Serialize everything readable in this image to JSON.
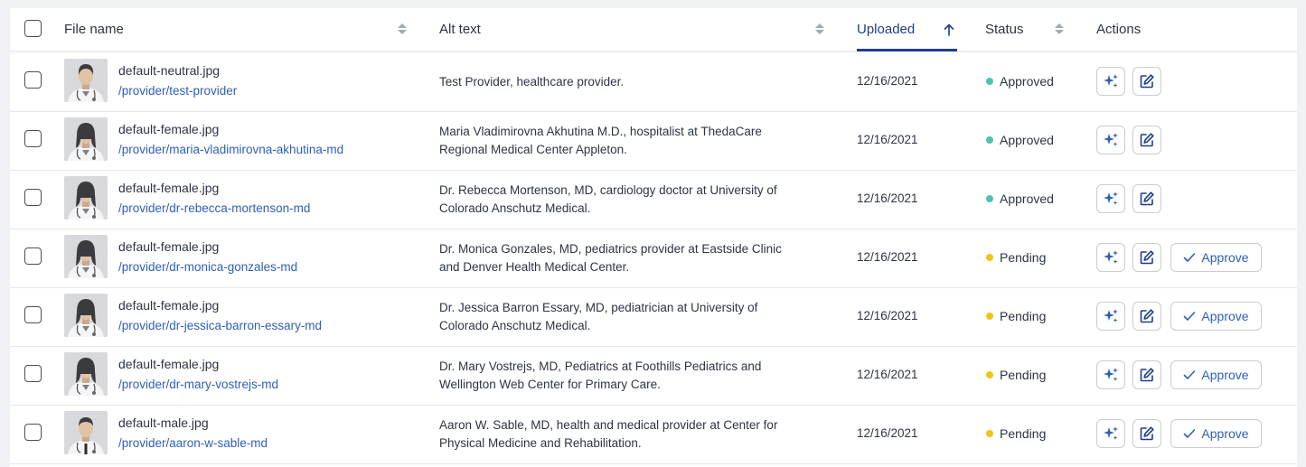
{
  "header": {
    "file_name": "File name",
    "alt_text": "Alt text",
    "uploaded": "Uploaded",
    "status": "Status",
    "actions": "Actions"
  },
  "colors": {
    "approved": "#4fc3b0",
    "pending": "#f0c419",
    "link": "#2e5fb5",
    "active_sort": "#1f3d8a"
  },
  "icons": {
    "ai": "sparkle-icon",
    "edit": "edit-icon",
    "approve": "check-icon"
  },
  "rows": [
    {
      "file": "default-neutral.jpg",
      "path": "/provider/test-provider",
      "alt": "Test Provider, healthcare provider.",
      "date": "12/16/2021",
      "status": "Approved",
      "avatar": "neutral"
    },
    {
      "file": "default-female.jpg",
      "path": "/provider/maria-vladimirovna-akhutina-md",
      "alt": "Maria Vladimirovna Akhutina M.D., hospitalist at ThedaCare Regional Medical Center Appleton.",
      "date": "12/16/2021",
      "status": "Approved",
      "avatar": "female"
    },
    {
      "file": "default-female.jpg",
      "path": "/provider/dr-rebecca-mortenson-md",
      "alt": "Dr. Rebecca Mortenson, MD, cardiology doctor at University of Colorado Anschutz Medical.",
      "date": "12/16/2021",
      "status": "Approved",
      "avatar": "female"
    },
    {
      "file": "default-female.jpg",
      "path": "/provider/dr-monica-gonzales-md",
      "alt": "Dr. Monica Gonzales, MD, pediatrics provider at Eastside Clinic and Denver Health Medical Center.",
      "date": "12/16/2021",
      "status": "Pending",
      "avatar": "female",
      "approve_label": "Approve"
    },
    {
      "file": "default-female.jpg",
      "path": "/provider/dr-jessica-barron-essary-md",
      "alt": "Dr. Jessica Barron Essary, MD, pediatrician at University of Colorado Anschutz Medical.",
      "date": "12/16/2021",
      "status": "Pending",
      "avatar": "female",
      "approve_label": "Approve"
    },
    {
      "file": "default-female.jpg",
      "path": "/provider/dr-mary-vostrejs-md",
      "alt": "Dr. Mary Vostrejs, MD, Pediatrics at Foothills Pediatrics and Wellington Web Center for Primary Care.",
      "date": "12/16/2021",
      "status": "Pending",
      "avatar": "female",
      "approve_label": "Approve"
    },
    {
      "file": "default-male.jpg",
      "path": "/provider/aaron-w-sable-md",
      "alt": "Aaron W. Sable, MD, health and medical provider at Center for Physical Medicine and Rehabilitation.",
      "date": "12/16/2021",
      "status": "Pending",
      "avatar": "male",
      "approve_label": "Approve"
    }
  ]
}
